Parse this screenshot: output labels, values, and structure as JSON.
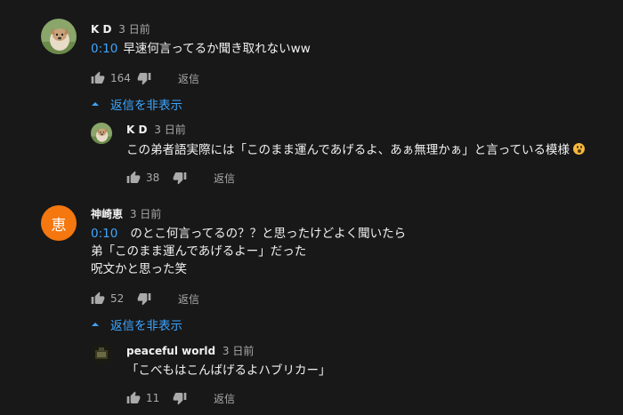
{
  "comments": [
    {
      "author": "K D",
      "time": "3 日前",
      "timestamp": "0:10",
      "text": "早速何言ってるか聞き取れないww",
      "likes": "164",
      "reply_label": "返信",
      "hide_replies_label": "返信を非表示",
      "avatar": "dog-photo-avatar"
    },
    {
      "author": "K D",
      "time": "3 日前",
      "text": "この弟者語実際には「このまま運んであげるよ、あぁ無理かぁ」と言っている模様",
      "likes": "38",
      "reply_label": "返信",
      "avatar": "dog-photo-avatar"
    },
    {
      "author": "神崎恵",
      "avatar_letter": "恵",
      "time": "3 日前",
      "timestamp": "0:10",
      "text_line1": "のとこ何言ってるの？？と思ったけどよく聞いたら",
      "text_line2": "弟「このまま運んであげるよー」だった",
      "text_line3": "呪文かと思った笑",
      "likes": "52",
      "reply_label": "返信",
      "hide_replies_label": "返信を非表示",
      "avatar_color": "#f4770f"
    },
    {
      "author": "peaceful world",
      "time": "3 日前",
      "text": "「こべもはこんばげるよハブリカー」",
      "likes": "11",
      "reply_label": "返信",
      "avatar": "dark-photo-avatar"
    }
  ],
  "colors": {
    "background": "#181818",
    "link": "#3ea6ff",
    "muted": "#aaaaaa",
    "text": "#f1f1f1"
  }
}
